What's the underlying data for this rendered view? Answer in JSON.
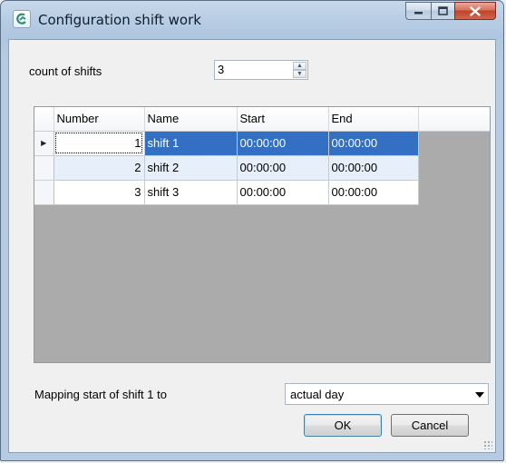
{
  "window": {
    "title": "Configuration shift work"
  },
  "shifts": {
    "count_label": "count of shifts",
    "count_value": "3"
  },
  "grid": {
    "columns": [
      "Number",
      "Name",
      "Start",
      "End"
    ],
    "rows": [
      {
        "number": "1",
        "name": "shift 1",
        "start": "00:00:00",
        "end": "00:00:00"
      },
      {
        "number": "2",
        "name": "shift 2",
        "start": "00:00:00",
        "end": "00:00:00"
      },
      {
        "number": "3",
        "name": "shift 3",
        "start": "00:00:00",
        "end": "00:00:00"
      }
    ],
    "selected_row": 1,
    "row_indicator_icon": "current-row-triangle-icon"
  },
  "mapping": {
    "label": "Mapping start of shift 1 to",
    "selected": "actual day"
  },
  "buttons": {
    "ok": "OK",
    "cancel": "Cancel"
  },
  "colors": {
    "selection": "#3370c4",
    "alt_row": "#e6effa",
    "close_button": "#c2412b"
  }
}
